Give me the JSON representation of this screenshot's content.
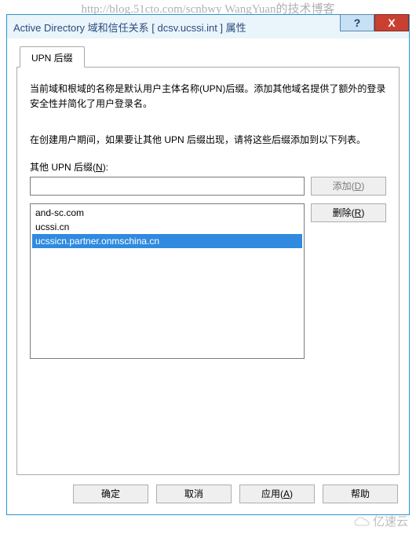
{
  "watermark_url": "http://blog.51cto.com/scnbwy WangYuan的技术博客",
  "title": "Active Directory 域和信任关系 [ dcsv.ucssi.int ] 属性",
  "titlebar": {
    "help": "?",
    "close": "X"
  },
  "tab_label": "UPN 后缀",
  "desc1": "当前域和根域的名称是默认用户主体名称(UPN)后缀。添加其他域名提供了额外的登录安全性并简化了用户登录名。",
  "desc2": "在创建用户期间，如果要让其他 UPN 后缀出现，请将这些后缀添加到以下列表。",
  "field_label_pre": "其他 UPN 后缀(",
  "field_label_u": "N",
  "field_label_post": "):",
  "input_value": "",
  "add_btn_pre": "添加(",
  "add_btn_u": "D",
  "add_btn_post": ")",
  "remove_btn_pre": "删除(",
  "remove_btn_u": "R",
  "remove_btn_post": ")",
  "list_items": [
    {
      "text": "and-sc.com",
      "selected": false
    },
    {
      "text": "ucssi.cn",
      "selected": false
    },
    {
      "text": "ucssicn.partner.onmschina.cn",
      "selected": true
    }
  ],
  "buttons": {
    "ok": "确定",
    "cancel": "取消",
    "apply_pre": "应用(",
    "apply_u": "A",
    "apply_post": ")",
    "help": "帮助"
  },
  "logo_text": "亿速云"
}
